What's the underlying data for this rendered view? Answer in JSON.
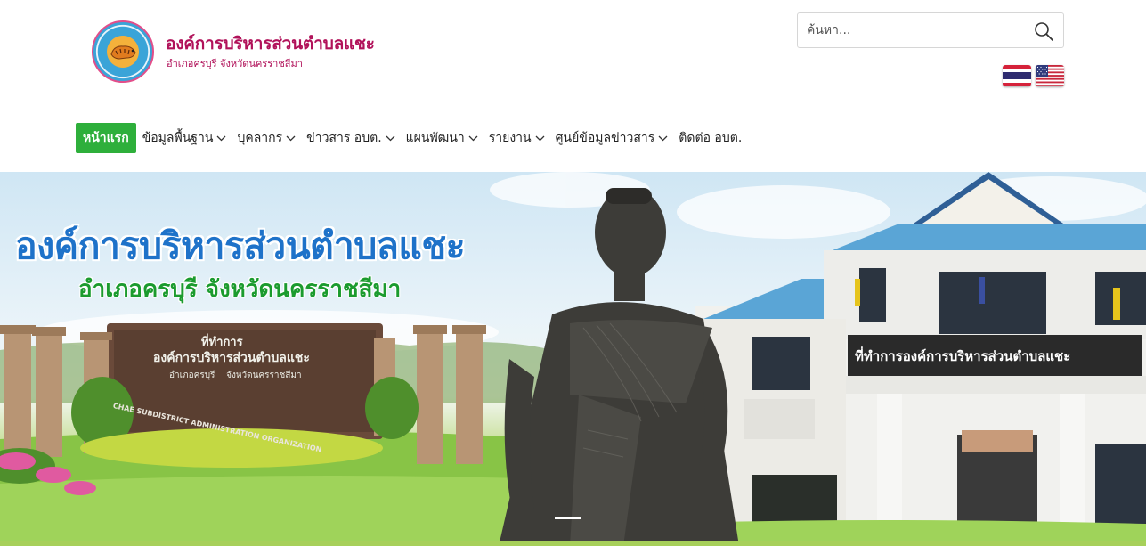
{
  "header": {
    "org_title": "องค์การบริหารส่วนตำบลแชะ",
    "org_subtitle": "อำเภอครบุรี จังหวัดนครราชสีมา",
    "logo_icon": "tiger-emblem-logo"
  },
  "search": {
    "placeholder": "ค้นหา...",
    "value": "",
    "icon": "search-icon"
  },
  "languages": [
    {
      "code": "th",
      "icon": "thai-flag-icon"
    },
    {
      "code": "en",
      "icon": "us-flag-icon"
    }
  ],
  "nav": {
    "home": "หน้าแรก",
    "items": [
      {
        "label": "ข้อมูลพื้นฐาน",
        "has_dropdown": true
      },
      {
        "label": "บุคลากร",
        "has_dropdown": true
      },
      {
        "label": "ข่าวสาร อบต.",
        "has_dropdown": true
      },
      {
        "label": "แผนพัฒนา",
        "has_dropdown": true
      },
      {
        "label": "รายงาน",
        "has_dropdown": true
      },
      {
        "label": "ศูนย์ข้อมูลข่าวสาร",
        "has_dropdown": true
      },
      {
        "label": "ติดต่อ อบต.",
        "has_dropdown": false
      }
    ]
  },
  "hero": {
    "title": "องค์การบริหารส่วนตำบลแชะ",
    "subtitle": "อำเภอครบุรี จังหวัดนครราชสีมา",
    "sign_left": {
      "line1": "ที่ทำการ",
      "line2": "องค์การบริหารส่วนตำบลแชะ",
      "line3": "อำเภอครบุรี    จังหวัดนครราชสีมา",
      "arc_text": "CHAE SUBDISTRICT ADMINISTRATION ORGANIZATION"
    },
    "building_sign": "ที่ทำการองค์การบริหารส่วนตำบลแชะ"
  },
  "colors": {
    "brand": "#b1125a",
    "nav_home_bg": "#2eaf3b",
    "hero_title": "#1e72c9",
    "hero_sub": "#1b9b2e"
  }
}
